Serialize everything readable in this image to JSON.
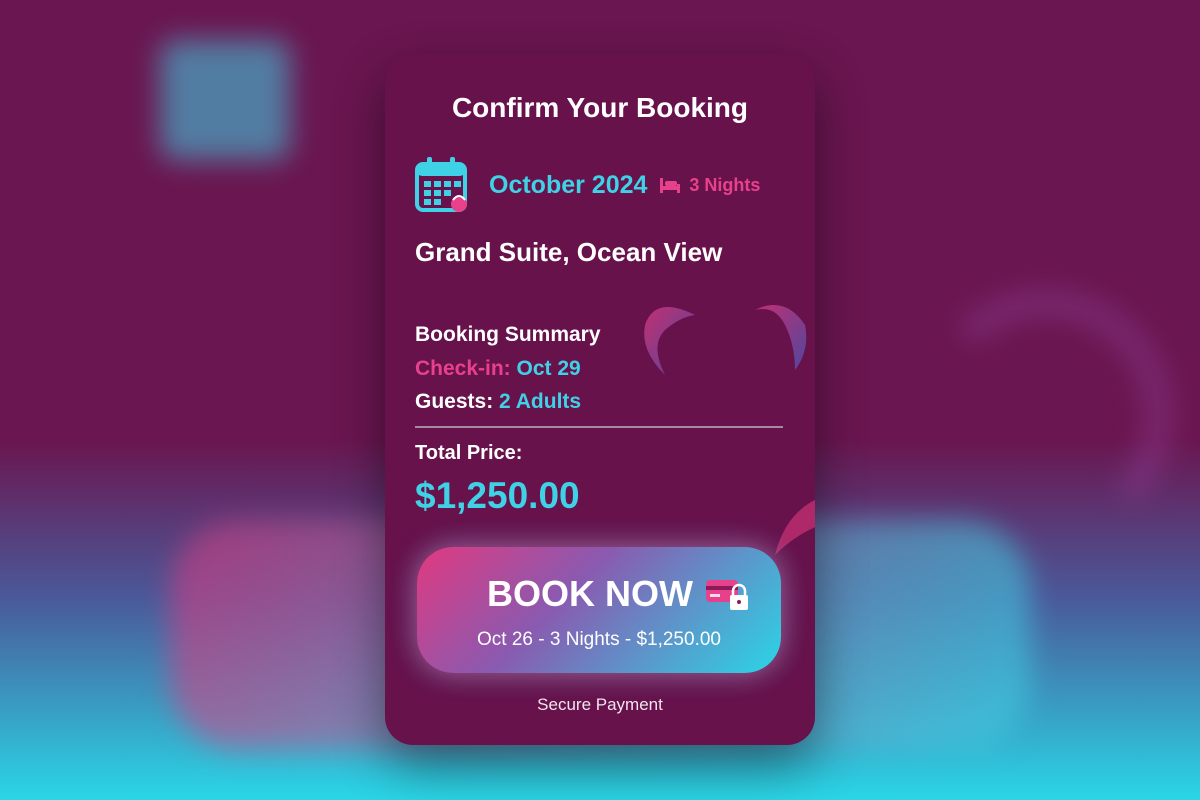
{
  "header": {
    "title": "Confirm Your Booking"
  },
  "booking": {
    "month": "October 2024",
    "nights": "3 Nights",
    "room": "Grand Suite, Ocean View"
  },
  "summary": {
    "label": "Booking Summary",
    "checkin_key": "Check-in:",
    "checkin_value": "Oct 29",
    "guests_key": "Guests:",
    "guests_value": "2 Adults",
    "total_label": "Total Price:",
    "total_value": "$1,250.00"
  },
  "cta": {
    "label": "BOOK NOW",
    "sub": "Oct 26 - 3 Nights - $1,250.00"
  },
  "footer": {
    "secure": "Secure Payment"
  },
  "icons": {
    "calendar": "calendar-icon",
    "bed": "bed-icon",
    "card_lock": "card-lock-icon"
  },
  "colors": {
    "card_bg": "#68124c",
    "accent_cyan": "#3fd2e6",
    "accent_pink": "#e8418c"
  }
}
